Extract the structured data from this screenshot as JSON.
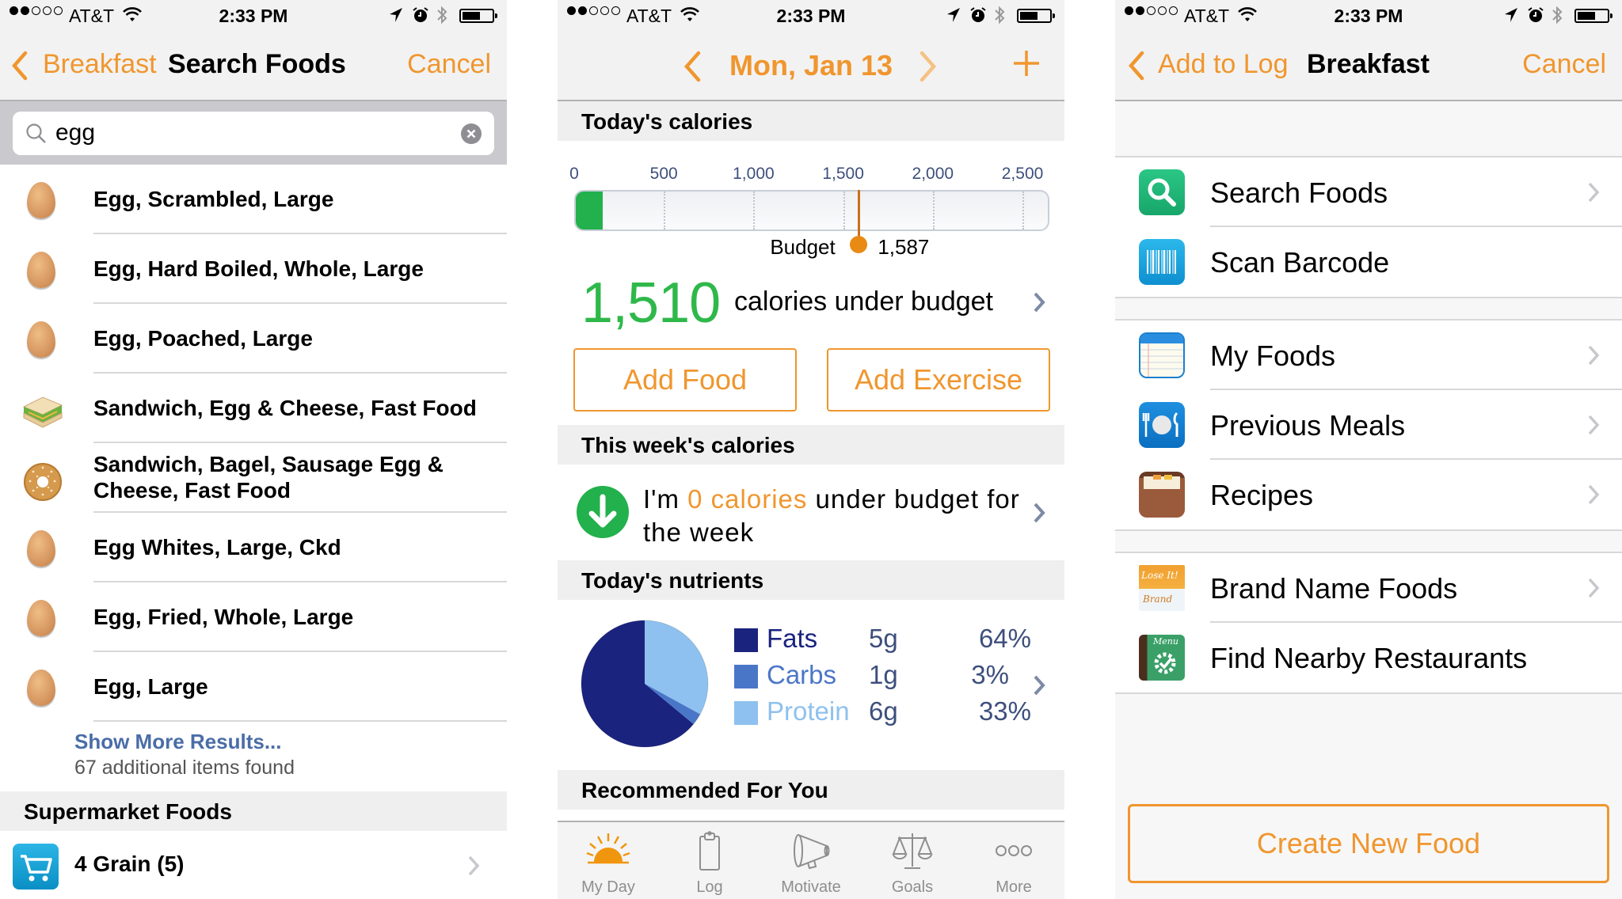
{
  "status_bar": {
    "carrier": "AT&T",
    "time": "2:33 PM",
    "signal_bars_filled": 2,
    "signal_bars_total": 5,
    "battery_level": 0.6
  },
  "colors": {
    "accent": "#f0962e",
    "green": "#22b14c",
    "link_blue": "#4a6da8",
    "fats": "#1a237e",
    "carbs": "#4a76c8",
    "protein": "#8ec1ef"
  },
  "search_screen": {
    "nav": {
      "back_label": "Breakfast",
      "title": "Search Foods",
      "cancel_label": "Cancel"
    },
    "search": {
      "value": "egg",
      "placeholder": ""
    },
    "results": [
      {
        "label": "Egg, Scrambled, Large",
        "icon": "egg"
      },
      {
        "label": "Egg, Hard Boiled, Whole, Large",
        "icon": "egg"
      },
      {
        "label": "Egg, Poached, Large",
        "icon": "egg"
      },
      {
        "label": "Sandwich, Egg & Cheese, Fast Food",
        "icon": "sandwich"
      },
      {
        "label": "Sandwich, Bagel, Sausage Egg & Cheese, Fast Food",
        "icon": "bagel"
      },
      {
        "label": "Egg Whites, Large, Ckd",
        "icon": "egg"
      },
      {
        "label": "Egg, Fried, Whole, Large",
        "icon": "egg"
      },
      {
        "label": "Egg, Large",
        "icon": "egg"
      }
    ],
    "show_more_label": "Show More Results...",
    "additional_found": "67 additional items found",
    "supermarket_header": "Supermarket Foods",
    "supermarket_items": [
      {
        "label": "4 Grain (5)",
        "icon": "shopping-cart"
      }
    ]
  },
  "my_day_screen": {
    "nav": {
      "date": "Mon, Jan 13",
      "prev": "‹",
      "next": "›",
      "add": "+"
    },
    "today_header": "Today's calories",
    "calorie_scale": [
      "0",
      "500",
      "1,000",
      "1,500",
      "2,000",
      "2,500"
    ],
    "calorie_scale_max": 2650,
    "calories_consumed": 77,
    "budget_label": "Budget",
    "budget_value": "1,587",
    "budget_number": 1587,
    "under_value": "1,510",
    "under_label": "calories under budget",
    "add_food_label": "Add Food",
    "add_exercise_label": "Add Exercise",
    "week_header": "This week's calories",
    "week_text_pre": "I'm ",
    "week_text_highlight": "0 calories",
    "week_text_post": " under budget for the week",
    "nutrients_header": "Today's nutrients",
    "recommended_header": "Recommended For You",
    "tabs": [
      {
        "label": "My Day",
        "icon": "sunrise-icon",
        "active": true
      },
      {
        "label": "Log",
        "icon": "clipboard-icon",
        "active": false
      },
      {
        "label": "Motivate",
        "icon": "megaphone-icon",
        "active": false
      },
      {
        "label": "Goals",
        "icon": "scale-icon",
        "active": false
      },
      {
        "label": "More",
        "icon": "more-icon",
        "active": false
      }
    ]
  },
  "chart_data": {
    "type": "pie",
    "title": "Today's nutrients",
    "categories": [
      "Fats",
      "Carbs",
      "Protein"
    ],
    "grams": [
      "5g",
      "1g",
      "6g"
    ],
    "values": [
      64,
      3,
      33
    ],
    "value_labels": [
      "64%",
      "3%",
      "33%"
    ],
    "start": "12 o'clock, clockwise from Protein",
    "legend_placement": "right"
  },
  "add_to_log_screen": {
    "nav": {
      "back_label": "Add to Log",
      "title": "Breakfast",
      "cancel_label": "Cancel"
    },
    "groups": [
      [
        {
          "label": "Search Foods",
          "icon": "search-foods-icon",
          "chevron": true
        },
        {
          "label": "Scan Barcode",
          "icon": "barcode-icon",
          "chevron": false
        }
      ],
      [
        {
          "label": "My Foods",
          "icon": "notepad-icon",
          "chevron": true
        },
        {
          "label": "Previous Meals",
          "icon": "plate-icon",
          "chevron": true
        },
        {
          "label": "Recipes",
          "icon": "recipe-box-icon",
          "chevron": true
        }
      ],
      [
        {
          "label": "Brand Name Foods",
          "icon": "brand-book-icon",
          "chevron": true
        },
        {
          "label": "Find Nearby Restaurants",
          "icon": "menu-book-icon",
          "chevron": false
        }
      ]
    ],
    "brand_icon_text_top": "Lose It!",
    "brand_icon_text_bottom": "Brand",
    "menu_icon_text": "Menu",
    "create_label": "Create New Food"
  }
}
